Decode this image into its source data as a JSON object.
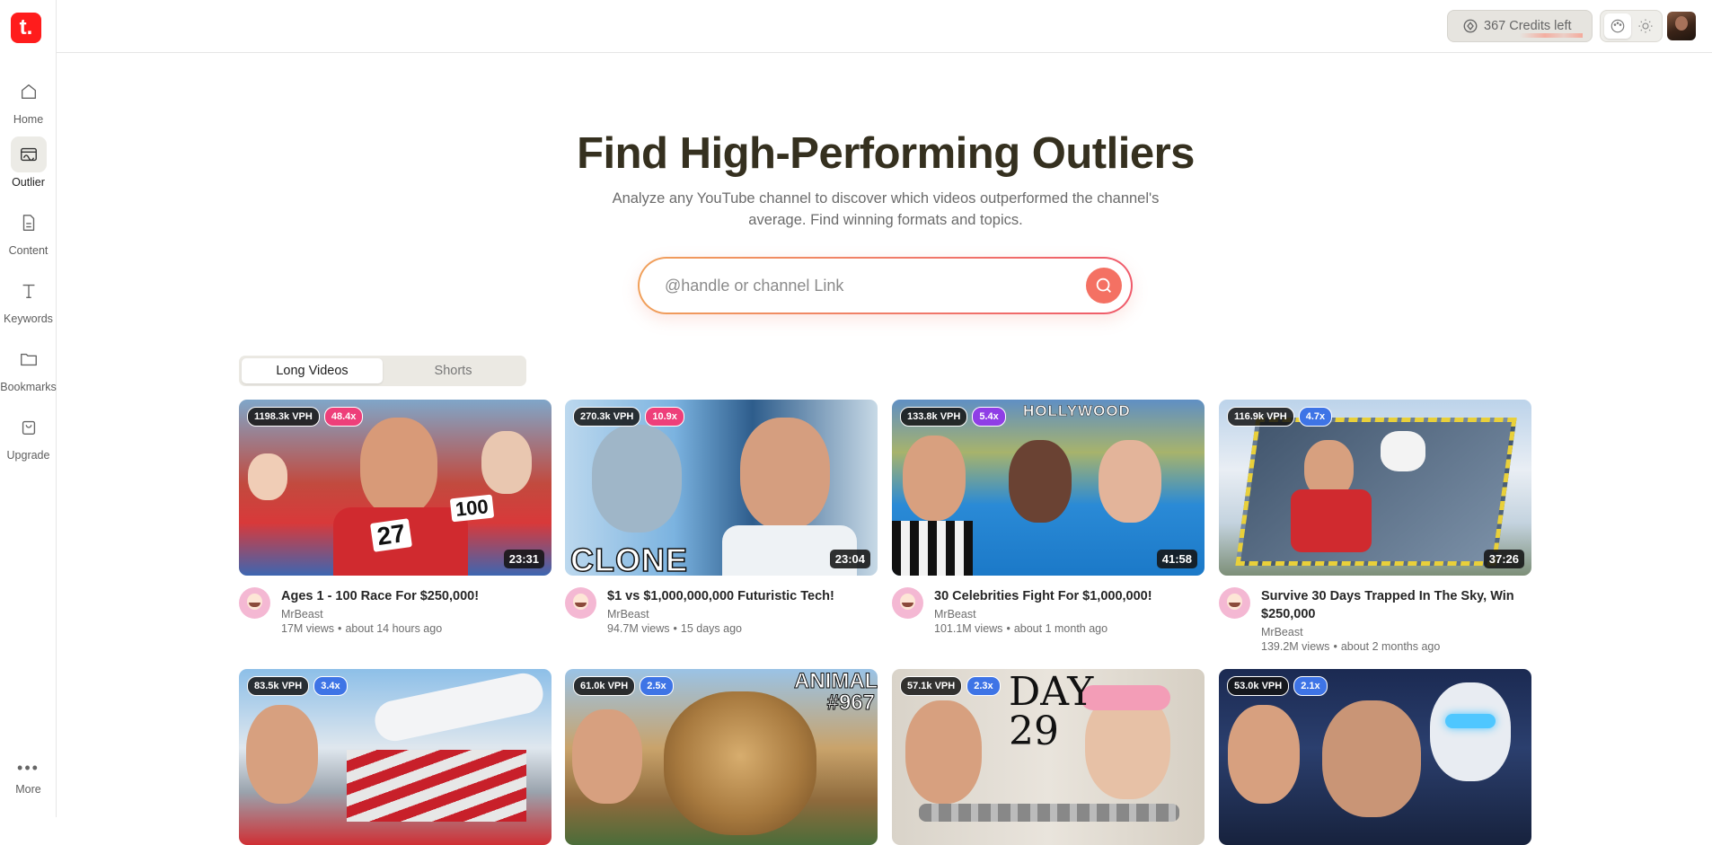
{
  "app": {
    "logo_letter": "t.",
    "brand_color": "#ff1c1c",
    "accent_color": "#f47163"
  },
  "sidebar": {
    "items": [
      {
        "label": "Home",
        "icon": "home-icon"
      },
      {
        "label": "Outlier",
        "icon": "outlier-icon"
      },
      {
        "label": "Content",
        "icon": "document-icon"
      },
      {
        "label": "Keywords",
        "icon": "text-icon"
      },
      {
        "label": "Bookmarks",
        "icon": "folder-icon"
      },
      {
        "label": "Upgrade",
        "icon": "bag-icon"
      }
    ],
    "more_label": "More",
    "active": "Outlier"
  },
  "topbar": {
    "credits_label": "367 Credits left"
  },
  "hero": {
    "title": "Find High-Performing Outliers",
    "subtitle": "Analyze any YouTube channel to discover which videos outperformed the channel's average. Find winning formats and topics."
  },
  "search": {
    "placeholder": "@handle or channel Link",
    "value": ""
  },
  "tabs": [
    {
      "label": "Long Videos",
      "active": true
    },
    {
      "label": "Shorts",
      "active": false
    }
  ],
  "videos": [
    {
      "vph": "1198.3k VPH",
      "mult": "48.4x",
      "mult_color": "#ee3f7a",
      "duration": "23:31",
      "title": "Ages 1 - 100 Race For $250,000!",
      "channel": "MrBeast",
      "views": "17M views",
      "age": "about 14 hours ago"
    },
    {
      "vph": "270.3k VPH",
      "mult": "10.9x",
      "mult_color": "#ee3f7a",
      "duration": "23:04",
      "title": "$1 vs $1,000,000,000 Futuristic Tech!",
      "channel": "MrBeast",
      "views": "94.7M views",
      "age": "15 days ago",
      "overlay": "CLONE"
    },
    {
      "vph": "133.8k VPH",
      "mult": "5.4x",
      "mult_color": "#8f3ee6",
      "duration": "41:58",
      "title": "30 Celebrities Fight For $1,000,000!",
      "channel": "MrBeast",
      "views": "101.1M views",
      "age": "about 1 month ago",
      "overlay": "HOLLYWOOD"
    },
    {
      "vph": "116.9k VPH",
      "mult": "4.7x",
      "mult_color": "#3e74e6",
      "duration": "37:26",
      "title": "Survive 30 Days Trapped In The Sky, Win $250,000",
      "channel": "MrBeast",
      "views": "139.2M views",
      "age": "about 2 months ago"
    },
    {
      "vph": "83.5k VPH",
      "mult": "3.4x",
      "mult_color": "#3e74e6"
    },
    {
      "vph": "61.0k VPH",
      "mult": "2.5x",
      "mult_color": "#3e74e6",
      "overlay": "ANIMAL #967"
    },
    {
      "vph": "57.1k VPH",
      "mult": "2.3x",
      "mult_color": "#3e74e6",
      "overlay": "DAY 29"
    },
    {
      "vph": "53.0k VPH",
      "mult": "2.1x",
      "mult_color": "#3e74e6"
    }
  ]
}
